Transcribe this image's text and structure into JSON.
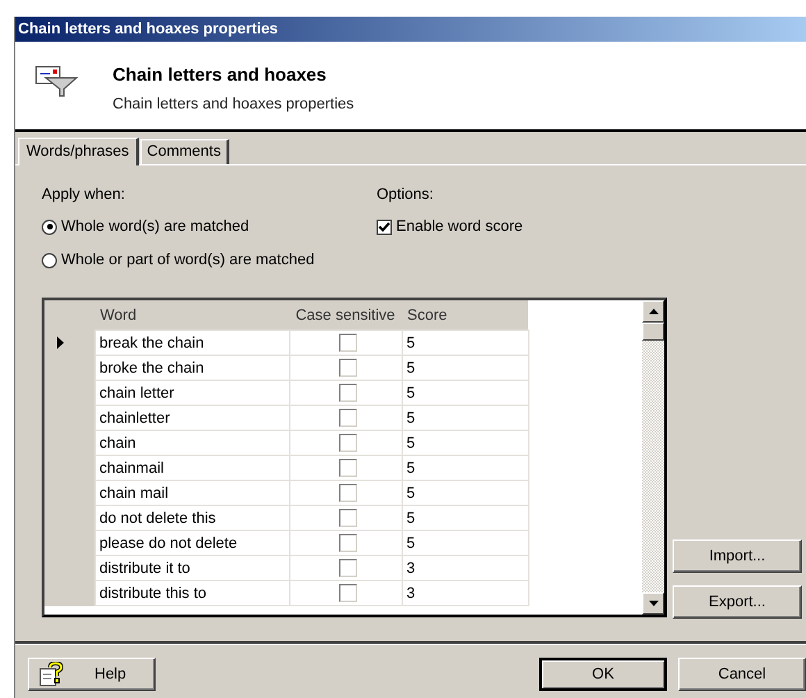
{
  "window": {
    "title": "Chain letters and hoaxes properties"
  },
  "header": {
    "title": "Chain letters and hoaxes",
    "subtitle": "Chain letters and hoaxes properties"
  },
  "tabs": [
    {
      "label": "Words/phrases",
      "selected": true
    },
    {
      "label": "Comments",
      "selected": false
    }
  ],
  "apply_when": {
    "label": "Apply when:",
    "options": [
      {
        "label": "Whole word(s) are matched",
        "selected": true
      },
      {
        "label": "Whole or part of word(s) are matched",
        "selected": false
      }
    ]
  },
  "options": {
    "label": "Options:",
    "items": [
      {
        "label": "Enable word score",
        "checked": true
      }
    ]
  },
  "table": {
    "columns": [
      "Word",
      "Case sensitive",
      "Score"
    ],
    "rows": [
      {
        "word": "break the chain",
        "case_sensitive": false,
        "score": "5",
        "current": true
      },
      {
        "word": "broke the chain",
        "case_sensitive": false,
        "score": "5",
        "current": false
      },
      {
        "word": "chain letter",
        "case_sensitive": false,
        "score": "5",
        "current": false
      },
      {
        "word": "chainletter",
        "case_sensitive": false,
        "score": "5",
        "current": false
      },
      {
        "word": "chain",
        "case_sensitive": false,
        "score": "5",
        "current": false
      },
      {
        "word": "chainmail",
        "case_sensitive": false,
        "score": "5",
        "current": false
      },
      {
        "word": "chain mail",
        "case_sensitive": false,
        "score": "5",
        "current": false
      },
      {
        "word": "do not delete this",
        "case_sensitive": false,
        "score": "5",
        "current": false
      },
      {
        "word": "please do not delete",
        "case_sensitive": false,
        "score": "5",
        "current": false
      },
      {
        "word": "distribute it to",
        "case_sensitive": false,
        "score": "3",
        "current": false
      },
      {
        "word": "distribute this to",
        "case_sensitive": false,
        "score": "3",
        "current": false
      }
    ]
  },
  "side_buttons": [
    "Import...",
    "Export..."
  ],
  "footer": {
    "help": "Help",
    "buttons": [
      {
        "label": "OK",
        "default": true
      },
      {
        "label": "Cancel",
        "default": false
      }
    ]
  }
}
